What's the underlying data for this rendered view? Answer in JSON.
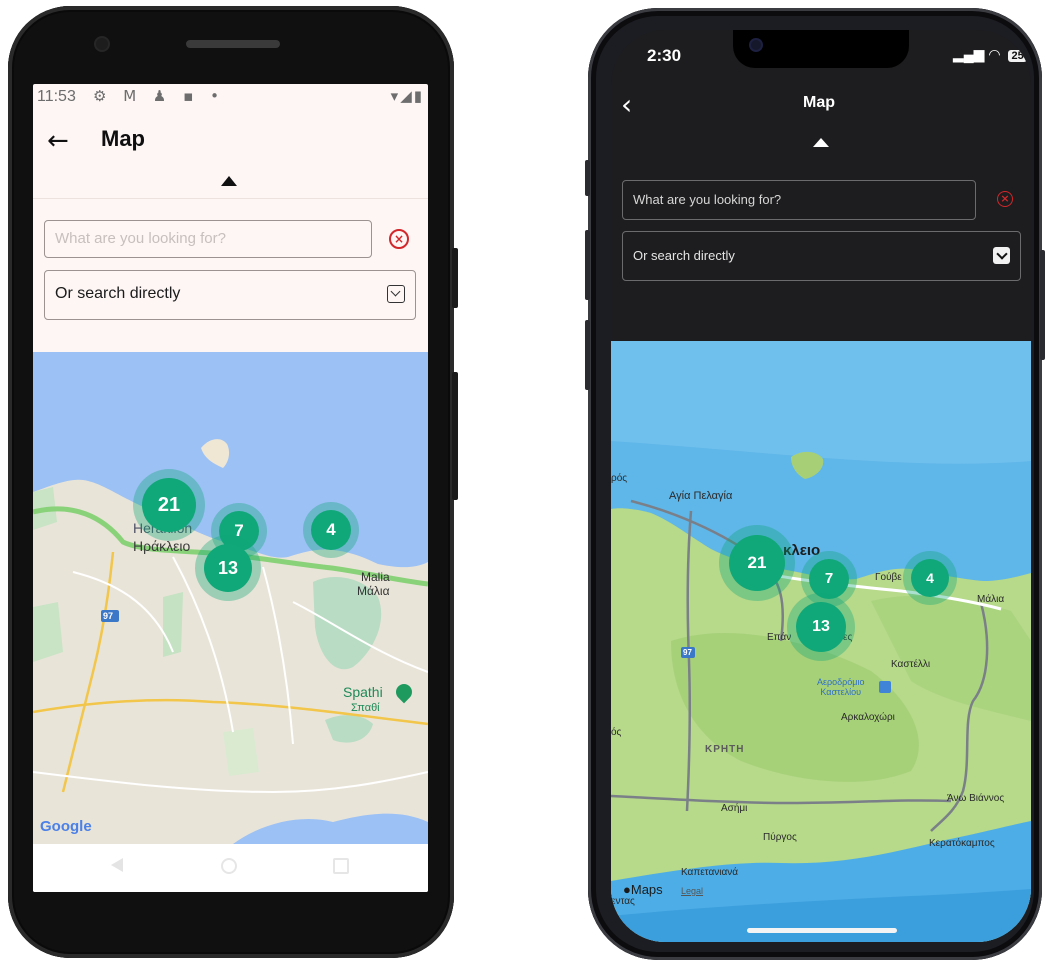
{
  "android": {
    "status": {
      "time": "11:53",
      "left_icons": "⚙ M ♟ ▪ •",
      "right_icons": "▾◢▮"
    },
    "header": {
      "back_icon": "←",
      "title": "Map"
    },
    "search": {
      "placeholder": "What are you looking for?",
      "clear_icon": "×"
    },
    "select": {
      "label": "Or search directly"
    },
    "map": {
      "clusters": [
        {
          "label": "21"
        },
        {
          "label": "7"
        },
        {
          "label": "13"
        },
        {
          "label": "4"
        }
      ],
      "places": {
        "heraklion_en": "Heraklion",
        "heraklion_gr": "Ηράκλειο",
        "malia_en": "Malia",
        "malia_gr": "Μάλια",
        "spathi_en": "Spathi",
        "spathi_gr": "Σπαθί",
        "road_97": "97"
      },
      "attribution": "Google"
    }
  },
  "ios": {
    "status": {
      "time": "2:30",
      "battery": "25"
    },
    "header": {
      "back_icon": "‹",
      "title": "Map"
    },
    "search": {
      "placeholder": "What are you looking for?",
      "clear_icon": "×"
    },
    "select": {
      "label": "Or search directly"
    },
    "map": {
      "clusters": [
        {
          "label": "21"
        },
        {
          "label": "7"
        },
        {
          "label": "13"
        },
        {
          "label": "4"
        }
      ],
      "places": {
        "agia_pelagia": "Αγία Πελαγία",
        "heraklion_partial": "κλειο",
        "gouves_partial": "Γούβε",
        "malia": "Μάλια",
        "epano_partial": "Επάν",
        "epano_suffix": "ες",
        "kastelli": "Καστέλλι",
        "airport": "Αεροδρόμιο\nΚαστελίου",
        "arkalochori": "Αρκαλοχώρι",
        "kriti": "ΚΡΗΤΗ",
        "asimi": "Ασήμι",
        "pyrgos": "Πύργος",
        "ano_viannos": "Άνω Βιάννος",
        "keratokampos": "Κερατόκαμπος",
        "kapetaniana": "Καπετανιανά",
        "left_edge_1": "ρός",
        "left_edge_2": "ός",
        "bottom_left_edge": "εντας",
        "road_97": "97"
      },
      "attribution": "Maps",
      "legal": "Legal"
    }
  },
  "colors": {
    "cluster": "#10a878",
    "cluster_halo": "rgba(15,165,120,0.35)",
    "clear_icon": "#d2272b",
    "android_bg": "#fdf6f4",
    "ios_bg": "#1d1d1f"
  }
}
